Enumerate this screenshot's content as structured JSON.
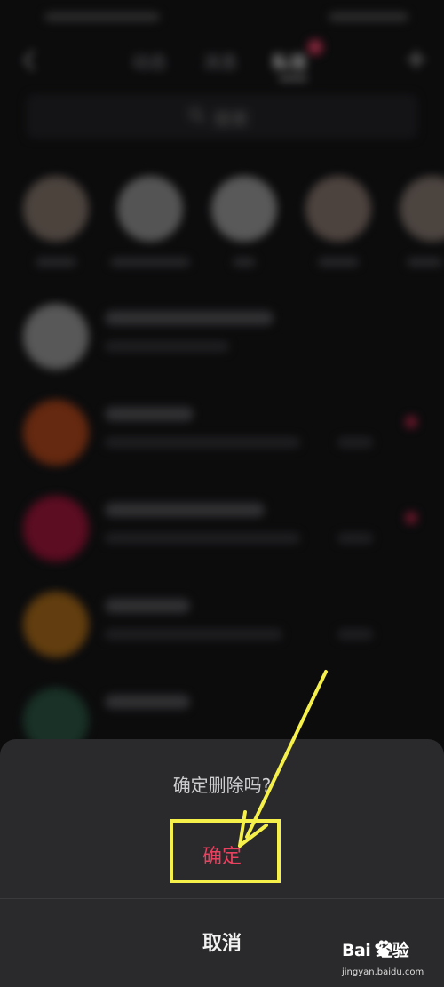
{
  "nav": {
    "tabs": [
      "动态",
      "消息",
      "私信"
    ],
    "badge": "1",
    "active": "私信"
  },
  "search": {
    "placeholder": "搜索"
  },
  "dialog": {
    "title": "确定删除吗?",
    "confirm_label": "确定",
    "cancel_label": "取消"
  },
  "watermark": {
    "logo": "Bai  经验",
    "url": "jingyan.baidu.com"
  },
  "colors": {
    "confirm": "#e9415f",
    "highlight": "#f6f04b",
    "sheet": "#2a2a2c"
  },
  "icons": [
    "back-icon",
    "plus-icon",
    "search-icon",
    "baidu-paw-icon"
  ]
}
